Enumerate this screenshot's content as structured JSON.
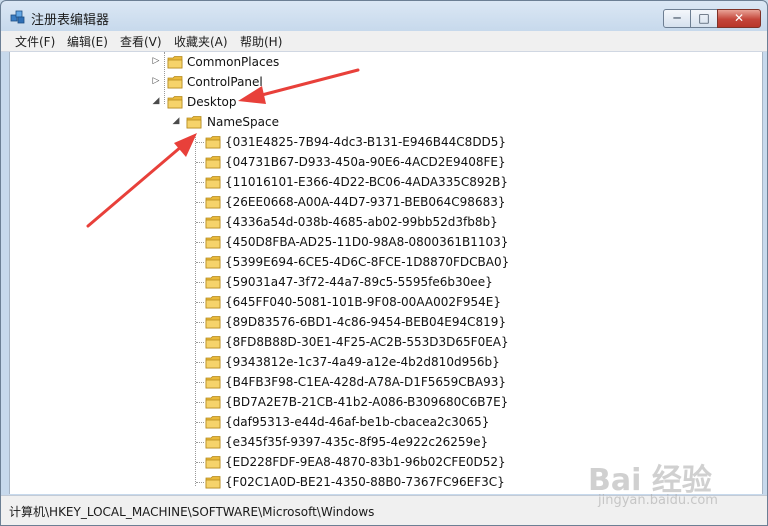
{
  "window": {
    "title": "注册表编辑器",
    "controls": {
      "minimize": "─",
      "maximize": "□",
      "close": "✕"
    }
  },
  "menu": [
    {
      "label": "文件(F)"
    },
    {
      "label": "编辑(E)"
    },
    {
      "label": "查看(V)"
    },
    {
      "label": "收藏夹(A)"
    },
    {
      "label": "帮助(H)"
    }
  ],
  "tree": {
    "nodes": [
      {
        "label": "CommonPlaces",
        "expander": "▷"
      },
      {
        "label": "ControlPanel",
        "expander": "▷"
      },
      {
        "label": "Desktop",
        "expander": "◢"
      }
    ],
    "namespace": {
      "label": "NameSpace",
      "expander": "◢"
    },
    "children": [
      "{031E4825-7B94-4dc3-B131-E946B44C8DD5}",
      "{04731B67-D933-450a-90E6-4ACD2E9408FE}",
      "{11016101-E366-4D22-BC06-4ADA335C892B}",
      "{26EE0668-A00A-44D7-9371-BEB064C98683}",
      "{4336a54d-038b-4685-ab02-99bb52d3fb8b}",
      "{450D8FBA-AD25-11D0-98A8-0800361B1103}",
      "{5399E694-6CE5-4D6C-8FCE-1D8870FDCBA0}",
      "{59031a47-3f72-44a7-89c5-5595fe6b30ee}",
      "{645FF040-5081-101B-9F08-00AA002F954E}",
      "{89D83576-6BD1-4c86-9454-BEB04E94C819}",
      "{8FD8B88D-30E1-4F25-AC2B-553D3D65F0EA}",
      "{9343812e-1c37-4a49-a12e-4b2d810d956b}",
      "{B4FB3F98-C1EA-428d-A78A-D1F5659CBA93}",
      "{BD7A2E7B-21CB-41b2-A086-B309680C6B7E}",
      "{daf95313-e44d-46af-be1b-cbacea2c3065}",
      "{e345f35f-9397-435c-8f95-4e922c26259e}",
      "{ED228FDF-9EA8-4870-83b1-96b02CFE0D52}",
      "{F02C1A0D-BE21-4350-88B0-7367FC96EF3C}"
    ]
  },
  "status": {
    "path": "计算机\\HKEY_LOCAL_MACHINE\\SOFTWARE\\Microsoft\\Windows"
  },
  "watermark": {
    "main": "Bai 经验",
    "sub": "jingyan.baidu.com"
  },
  "colors": {
    "arrow": "#e8403a",
    "folder": "#e9b93b",
    "titlebar": "#c7d9ec"
  }
}
